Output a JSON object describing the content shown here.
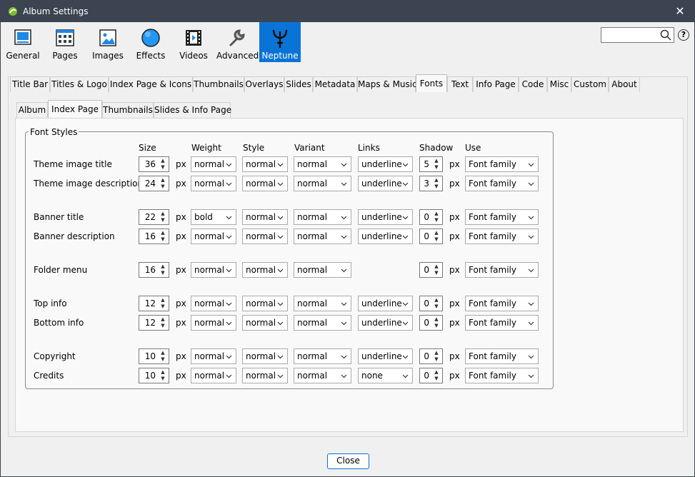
{
  "window": {
    "title": "Album Settings"
  },
  "toolbar": [
    {
      "label": "General"
    },
    {
      "label": "Pages"
    },
    {
      "label": "Images"
    },
    {
      "label": "Effects"
    },
    {
      "label": "Videos"
    },
    {
      "label": "Advanced"
    },
    {
      "label": "Neptune"
    }
  ],
  "tabs": [
    "Title Bar",
    "Titles & Logo",
    "Index Page & Icons",
    "Thumbnails",
    "Overlays",
    "Slides",
    "Metadata",
    "Maps & Music",
    "Fonts",
    "Text",
    "Info Page",
    "Code",
    "Misc",
    "Custom",
    "About"
  ],
  "subtabs": [
    "Album",
    "Index Page",
    "Thumbnails",
    "Slides & Info Page"
  ],
  "fieldset_title": "Font Styles",
  "columns": {
    "size": "Size",
    "weight": "Weight",
    "style": "Style",
    "variant": "Variant",
    "links": "Links",
    "shadow": "Shadow",
    "use": "Use"
  },
  "unit": "px",
  "rows": [
    {
      "label": "Theme image title",
      "size": "36",
      "weight": "normal",
      "style": "normal",
      "variant": "normal",
      "links": "underline",
      "shadow": "5",
      "use": "Font family"
    },
    {
      "label": "Theme image description",
      "size": "24",
      "weight": "normal",
      "style": "normal",
      "variant": "normal",
      "links": "underline",
      "shadow": "3",
      "use": "Font family"
    },
    {
      "label": "Banner title",
      "size": "22",
      "weight": "bold",
      "style": "normal",
      "variant": "normal",
      "links": "underline",
      "shadow": "0",
      "use": "Font family"
    },
    {
      "label": "Banner description",
      "size": "16",
      "weight": "normal",
      "style": "normal",
      "variant": "normal",
      "links": "underline",
      "shadow": "0",
      "use": "Font family"
    },
    {
      "label": "Folder menu",
      "size": "16",
      "weight": "normal",
      "style": "normal",
      "variant": "normal",
      "links": "",
      "shadow": "0",
      "use": "Font family"
    },
    {
      "label": "Top info",
      "size": "12",
      "weight": "normal",
      "style": "normal",
      "variant": "normal",
      "links": "underline",
      "shadow": "0",
      "use": "Font family"
    },
    {
      "label": "Bottom info",
      "size": "12",
      "weight": "normal",
      "style": "normal",
      "variant": "normal",
      "links": "underline",
      "shadow": "0",
      "use": "Font family"
    },
    {
      "label": "Copyright",
      "size": "10",
      "weight": "normal",
      "style": "normal",
      "variant": "normal",
      "links": "underline",
      "shadow": "0",
      "use": "Font family"
    },
    {
      "label": "Credits",
      "size": "10",
      "weight": "normal",
      "style": "normal",
      "variant": "normal",
      "links": "none",
      "shadow": "0",
      "use": "Font family"
    }
  ],
  "close_label": "Close",
  "icons": {
    "help": "?",
    "close": "✕"
  },
  "colors": {
    "titlebar": "#3b4450",
    "accent": "#0a74d6"
  }
}
